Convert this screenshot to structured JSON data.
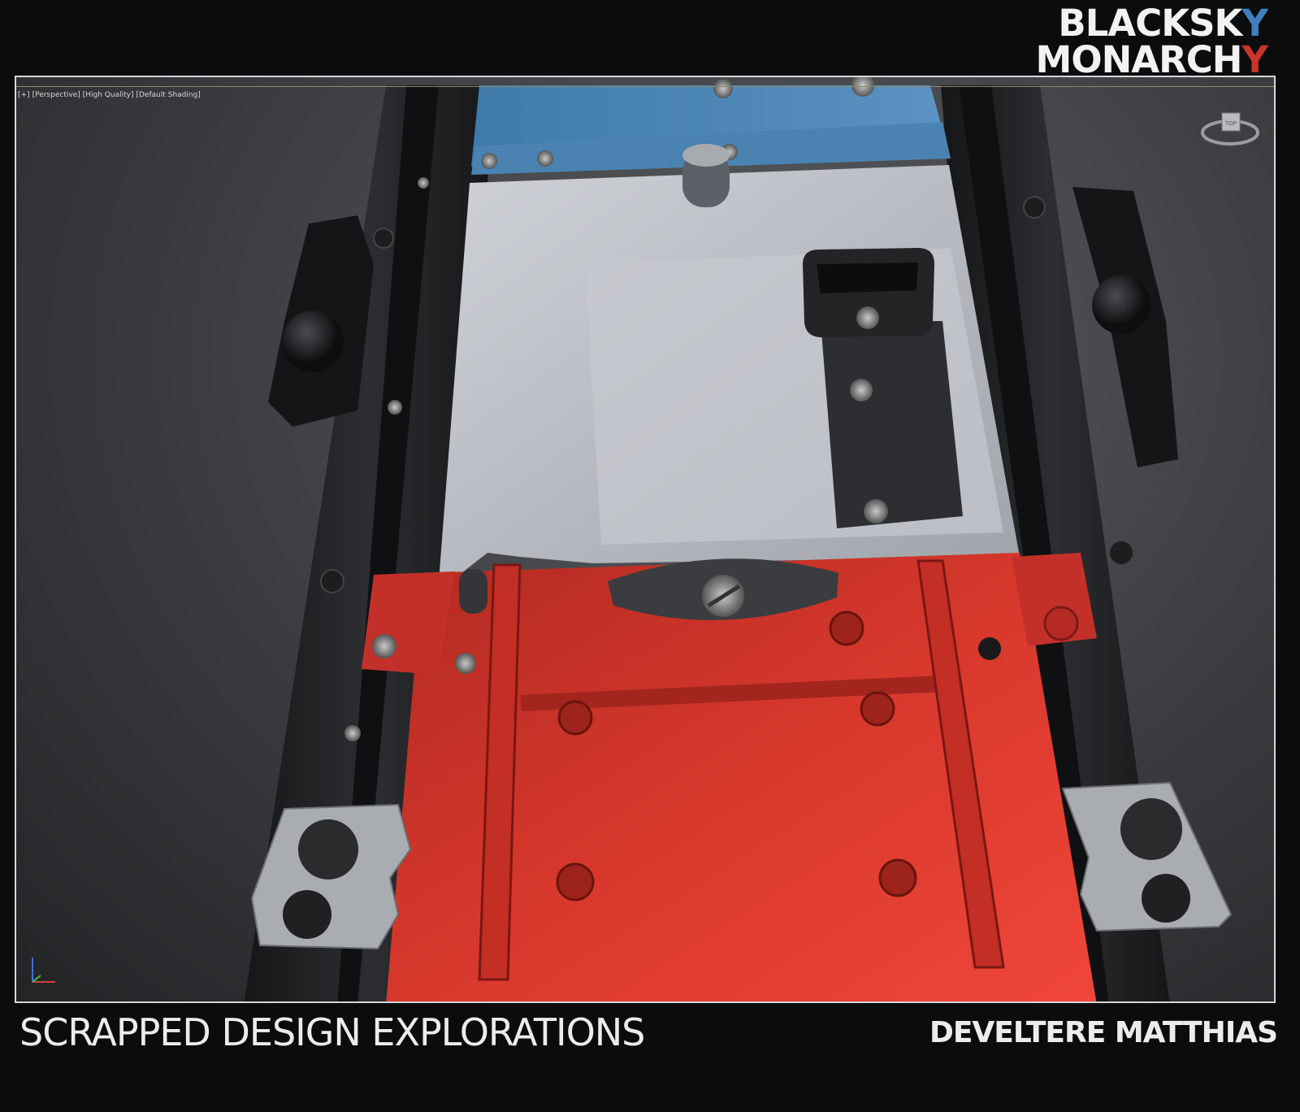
{
  "logo": {
    "line1": "BLACKSK",
    "line1_accent": "Y",
    "line2": "MONARCH",
    "line2_accent": "Y",
    "colors": {
      "text": "#f2f2f2",
      "blue": "#3f7fc0",
      "red": "#c8342a"
    }
  },
  "viewport": {
    "labels": [
      "[+]",
      "[Perspective]",
      "[High Quality]",
      "[Default Shading]"
    ],
    "viewcube_icon": "viewcube-icon",
    "axis_icon": "axis-gizmo-icon",
    "colors": {
      "blue_plate": "#4f86b4",
      "grey_plate": "#b9bdc4",
      "red_plate": "#d8382c",
      "rail": "#1f2123"
    }
  },
  "footer": {
    "title": "SCRAPPED DESIGN EXPLORATIONS",
    "author": "DEVELTERE MATTHIAS"
  }
}
